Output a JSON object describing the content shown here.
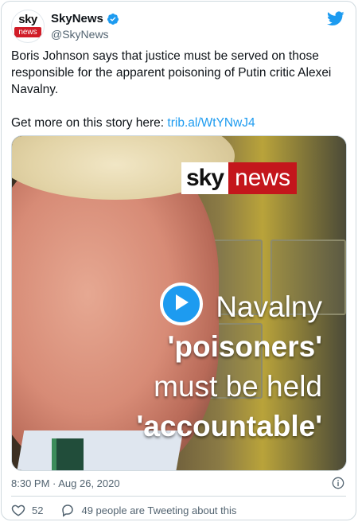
{
  "account": {
    "display_name": "SkyNews",
    "handle": "@SkyNews",
    "avatar_text_top": "sky",
    "avatar_text_bottom": "news"
  },
  "tweet": {
    "text": "Boris Johnson says that justice must be served on those responsible for the apparent poisoning of Putin critic Alexei Navalny.",
    "link_prefix": "Get more on this story here: ",
    "link_text": "trib.al/WtYNwJ4"
  },
  "media": {
    "logo_sky": "sky",
    "logo_news": "news",
    "headline_line1": "Navalny",
    "headline_line2": "'poisoners'",
    "headline_line3": "must be held",
    "headline_line4": "'accountable'"
  },
  "meta": {
    "timestamp": "8:30 PM · Aug 26, 2020",
    "like_count": "52",
    "conversation_text": "49 people are Tweeting about this"
  },
  "colors": {
    "accent": "#1d9bf0",
    "sky_red": "#c4161c",
    "muted": "#536471"
  },
  "icons": [
    "verified-icon",
    "twitter-bird-icon",
    "play-icon",
    "info-icon",
    "heart-icon",
    "reply-icon"
  ]
}
